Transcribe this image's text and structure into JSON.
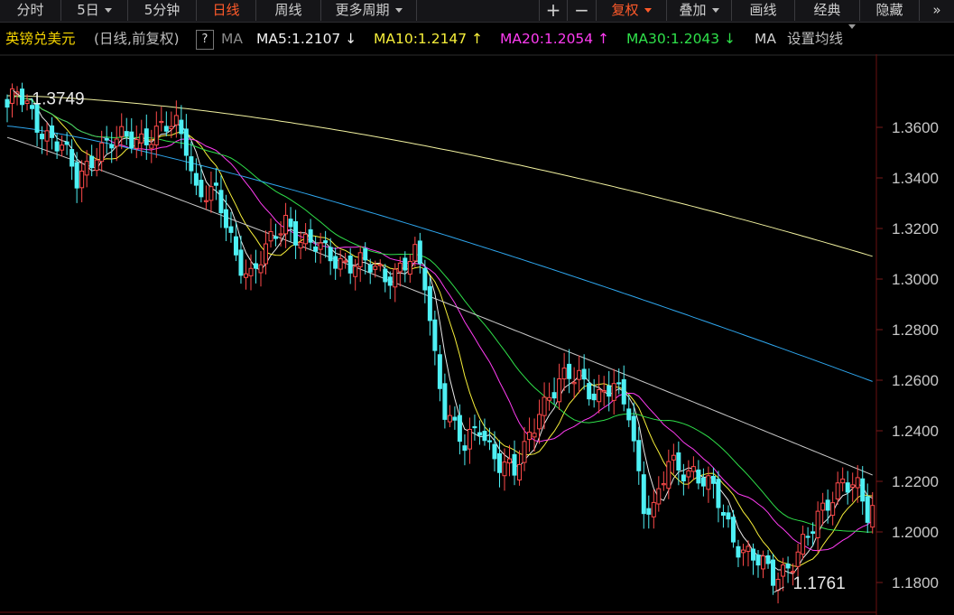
{
  "toolbar": {
    "intraday": "分时",
    "five_day": "5日",
    "five_min": "5分钟",
    "daily": "日线",
    "weekly": "周线",
    "more_periods": "更多周期",
    "zoom_in": "+",
    "zoom_out": "−",
    "adjust": "复权",
    "overlay": "叠加",
    "draw": "画线",
    "classic": "经典",
    "hide": "隐藏",
    "expand": "»"
  },
  "legend": {
    "name": "英镑兑美元",
    "mode": "(日线,前复权)",
    "help": "?",
    "ma_label": "MA",
    "ma5": "MA5:1.2107",
    "ma5_arrow": "↓",
    "ma10": "MA10:1.2147",
    "ma10_arrow": "↑",
    "ma20": "MA20:1.2054",
    "ma20_arrow": "↑",
    "ma30": "MA30:1.2043",
    "ma30_arrow": "↓",
    "ma_more": "MA",
    "settings": "设置均线"
  },
  "colors": {
    "up": "#ff4a4a",
    "down": "#4ef0f4",
    "ma5": "#e8e8e8",
    "ma10": "#f7ef3a",
    "ma20": "#ff3cf2",
    "ma30": "#2fe04a",
    "ma60": "#c8c8c8",
    "ma120": "#2ea6ee",
    "ma250": "#f2f2a0",
    "active": "#ff5a2a"
  },
  "chart_data": {
    "type": "candlestick",
    "symbol": "英镑兑美元",
    "period": "日线",
    "y_ticks": [
      "1.3600",
      "1.3400",
      "1.3200",
      "1.3000",
      "1.2800",
      "1.2600",
      "1.2400",
      "1.2200",
      "1.2000",
      "1.1800"
    ],
    "ylim": [
      1.1745,
      1.3775
    ],
    "annotations": [
      {
        "label": "1.3749",
        "value": 1.3749,
        "bar": 1
      },
      {
        "label": "1.1761",
        "value": 1.1761,
        "bar": 154
      }
    ],
    "close_keypoints": [
      [
        0,
        1.368
      ],
      [
        2,
        1.3725
      ],
      [
        6,
        1.362
      ],
      [
        11,
        1.352
      ],
      [
        14,
        1.338
      ],
      [
        18,
        1.352
      ],
      [
        24,
        1.355
      ],
      [
        30,
        1.358
      ],
      [
        34,
        1.36
      ],
      [
        36,
        1.354
      ],
      [
        38,
        1.336
      ],
      [
        42,
        1.332
      ],
      [
        46,
        1.31
      ],
      [
        49,
        1.302
      ],
      [
        52,
        1.31
      ],
      [
        56,
        1.324
      ],
      [
        60,
        1.314
      ],
      [
        64,
        1.31
      ],
      [
        70,
        1.306
      ],
      [
        76,
        1.302
      ],
      [
        82,
        1.308
      ],
      [
        84,
        1.298
      ],
      [
        86,
        1.27
      ],
      [
        88,
        1.25
      ],
      [
        92,
        1.232
      ],
      [
        95,
        1.242
      ],
      [
        99,
        1.228
      ],
      [
        102,
        1.222
      ],
      [
        104,
        1.232
      ],
      [
        107,
        1.25
      ],
      [
        111,
        1.258
      ],
      [
        115,
        1.262
      ],
      [
        119,
        1.254
      ],
      [
        122,
        1.256
      ],
      [
        125,
        1.248
      ],
      [
        128,
        1.212
      ],
      [
        130,
        1.208
      ],
      [
        133,
        1.226
      ],
      [
        138,
        1.225
      ],
      [
        142,
        1.215
      ],
      [
        146,
        1.198
      ],
      [
        150,
        1.19
      ],
      [
        154,
        1.181
      ],
      [
        158,
        1.19
      ],
      [
        162,
        1.2
      ],
      [
        165,
        1.212
      ],
      [
        168,
        1.222
      ],
      [
        171,
        1.216
      ],
      [
        173,
        1.205
      ],
      [
        174,
        1.208
      ]
    ],
    "moving_averages": {
      "MA5": {
        "last": 1.2107,
        "arrow": "down"
      },
      "MA10": {
        "last": 1.2147,
        "arrow": "up"
      },
      "MA20": {
        "last": 1.2054,
        "arrow": "up"
      },
      "MA30": {
        "last": 1.2043,
        "arrow": "down"
      },
      "MA60_end": 1.2225,
      "MA120_end": 1.2595,
      "MA250_end": 1.309,
      "MA250_start": 1.3725,
      "MA120_start": 1.3605,
      "MA60_start": 1.356
    }
  }
}
